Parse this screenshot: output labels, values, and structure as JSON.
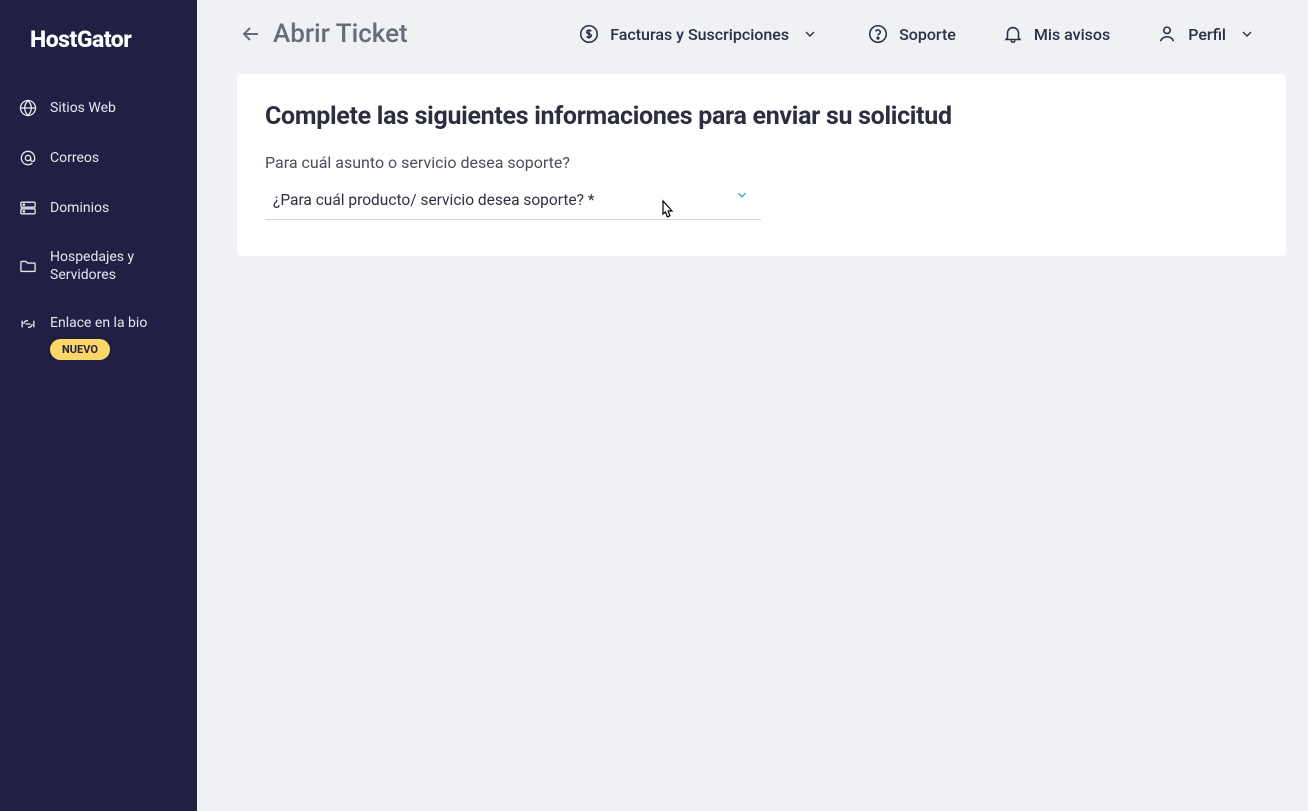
{
  "brand": "HostGator",
  "sidebar": {
    "items": [
      {
        "label": "Sitios Web"
      },
      {
        "label": "Correos"
      },
      {
        "label": "Dominios"
      },
      {
        "label": "Hospedajes y Servidores"
      },
      {
        "label": "Enlace en la bio",
        "badge": "NUEVO"
      }
    ]
  },
  "topbar": {
    "back_title": "Abrir Ticket",
    "billing": "Facturas y Suscripciones",
    "support": "Soporte",
    "notices": "Mis avisos",
    "profile": "Perfil"
  },
  "card": {
    "title": "Complete las siguientes informaciones para enviar su solicitud",
    "field_label": "Para cuál asunto o servicio desea soporte?",
    "select_placeholder": "¿Para cuál producto/ servicio desea soporte? *"
  }
}
